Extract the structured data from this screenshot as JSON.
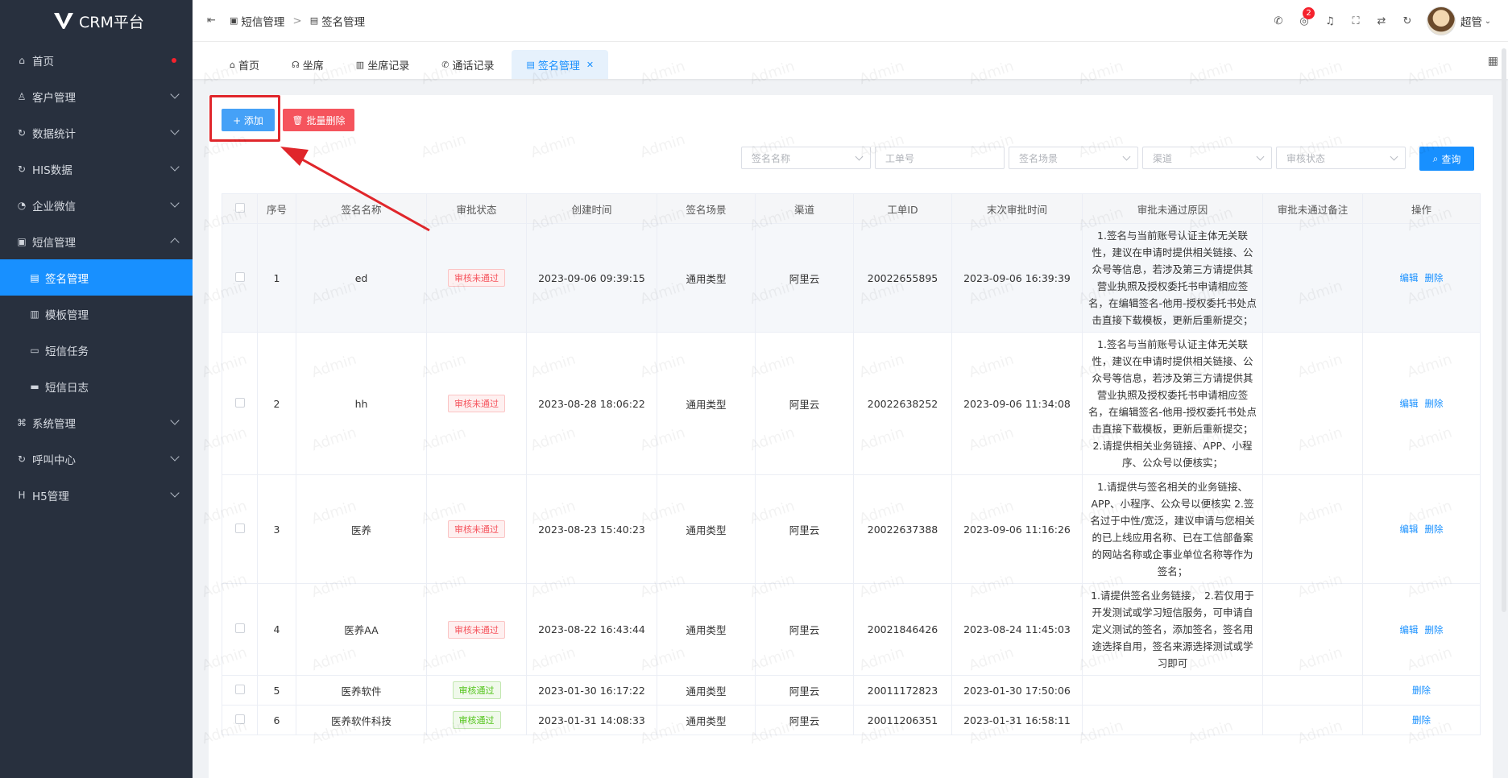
{
  "app": {
    "title": "CRM平台"
  },
  "sidebar": {
    "items": [
      {
        "label": "首页",
        "icon": "home-icon",
        "has_dot": true
      },
      {
        "label": "客户管理",
        "icon": "user-icon"
      },
      {
        "label": "数据统计",
        "icon": "stats-icon"
      },
      {
        "label": "HIS数据",
        "icon": "stats-icon"
      },
      {
        "label": "企业微信",
        "icon": "wechat-icon"
      },
      {
        "label": "短信管理",
        "icon": "message-icon",
        "expanded": true
      },
      {
        "label": "签名管理",
        "icon": "doc-icon",
        "sub": true,
        "active": true
      },
      {
        "label": "模板管理",
        "icon": "template-icon",
        "sub": true
      },
      {
        "label": "短信任务",
        "icon": "task-icon",
        "sub": true
      },
      {
        "label": "短信日志",
        "icon": "log-icon",
        "sub": true
      },
      {
        "label": "系统管理",
        "icon": "settings-icon"
      },
      {
        "label": "呼叫中心",
        "icon": "stats-icon"
      },
      {
        "label": "H5管理",
        "icon": "h5-icon"
      }
    ]
  },
  "header": {
    "breadcrumb": [
      "短信管理",
      "签名管理"
    ],
    "notification_count": "2",
    "username": "超管"
  },
  "tabs": [
    {
      "label": "首页"
    },
    {
      "label": "坐席"
    },
    {
      "label": "坐席记录"
    },
    {
      "label": "通话记录"
    },
    {
      "label": "签名管理",
      "active": true
    }
  ],
  "toolbar": {
    "add_label": "+ 添加",
    "batch_delete_label": "批量删除",
    "query_label": "查询"
  },
  "filters": {
    "signature_name_placeholder": "签名名称",
    "ticket_no_placeholder": "工单号",
    "scene_placeholder": "签名场景",
    "channel_placeholder": "渠道",
    "audit_status_placeholder": "审核状态"
  },
  "table": {
    "headers": [
      "序号",
      "签名名称",
      "审批状态",
      "创建时间",
      "签名场景",
      "渠道",
      "工单ID",
      "末次审批时间",
      "审批未通过原因",
      "审批未通过备注",
      "操作"
    ],
    "rows": [
      {
        "index": "1",
        "name": "ed",
        "status": "审核未通过",
        "status_type": "fail",
        "created": "2023-09-06 09:39:15",
        "scene": "通用类型",
        "channel": "阿里云",
        "ticket": "20022655895",
        "last_audit": "2023-09-06 16:39:39",
        "reason": "1.签名与当前账号认证主体无关联性，建议在申请时提供相关链接、公众号等信息，若涉及第三方请提供其营业执照及授权委托书申请相应签名，在编辑签名-他用-授权委托书处点击直接下载模板，更新后重新提交；",
        "remark": "",
        "edit": "编辑",
        "delete": "删除"
      },
      {
        "index": "2",
        "name": "hh",
        "status": "审核未通过",
        "status_type": "fail",
        "created": "2023-08-28 18:06:22",
        "scene": "通用类型",
        "channel": "阿里云",
        "ticket": "20022638252",
        "last_audit": "2023-09-06 11:34:08",
        "reason": "1.签名与当前账号认证主体无关联性，建议在申请时提供相关链接、公众号等信息，若涉及第三方请提供其营业执照及授权委托书申请相应签名，在编辑签名-他用-授权委托书处点击直接下载模板，更新后重新提交； 2.请提供相关业务链接、APP、小程序、公众号以便核实；",
        "remark": "",
        "edit": "编辑",
        "delete": "删除"
      },
      {
        "index": "3",
        "name": "医养",
        "status": "审核未通过",
        "status_type": "fail",
        "created": "2023-08-23 15:40:23",
        "scene": "通用类型",
        "channel": "阿里云",
        "ticket": "20022637388",
        "last_audit": "2023-09-06 11:16:26",
        "reason": "1.请提供与签名相关的业务链接、APP、小程序、公众号以便核实 2.签名过于中性/宽泛，建议申请与您相关的已上线应用名称、已在工信部备案的网站名称或企事业单位名称等作为签名；",
        "remark": "",
        "edit": "编辑",
        "delete": "删除"
      },
      {
        "index": "4",
        "name": "医养AA",
        "status": "审核未通过",
        "status_type": "fail",
        "created": "2023-08-22 16:43:44",
        "scene": "通用类型",
        "channel": "阿里云",
        "ticket": "20021846426",
        "last_audit": "2023-08-24 11:45:03",
        "reason": "1.请提供签名业务链接， 2.若仅用于开发测试或学习短信服务，可申请自定义测试的签名，添加签名，签名用途选择自用，签名来源选择测试或学习即可",
        "remark": "",
        "edit": "编辑",
        "delete": "删除"
      },
      {
        "index": "5",
        "name": "医养软件",
        "status": "审核通过",
        "status_type": "pass",
        "created": "2023-01-30 16:17:22",
        "scene": "通用类型",
        "channel": "阿里云",
        "ticket": "20011172823",
        "last_audit": "2023-01-30 17:50:06",
        "reason": "",
        "remark": "",
        "edit": "",
        "delete": "删除"
      },
      {
        "index": "6",
        "name": "医养软件科技",
        "status": "审核通过",
        "status_type": "pass",
        "created": "2023-01-31 14:08:33",
        "scene": "通用类型",
        "channel": "阿里云",
        "ticket": "20011206351",
        "last_audit": "2023-01-31 16:58:11",
        "reason": "",
        "remark": "",
        "edit": "",
        "delete": "删除"
      }
    ]
  },
  "watermark": "Admin",
  "colors": {
    "primary": "#1890ff",
    "danger": "#f5545d",
    "sidebar_bg": "#28303e",
    "annotation": "#e0262b"
  }
}
